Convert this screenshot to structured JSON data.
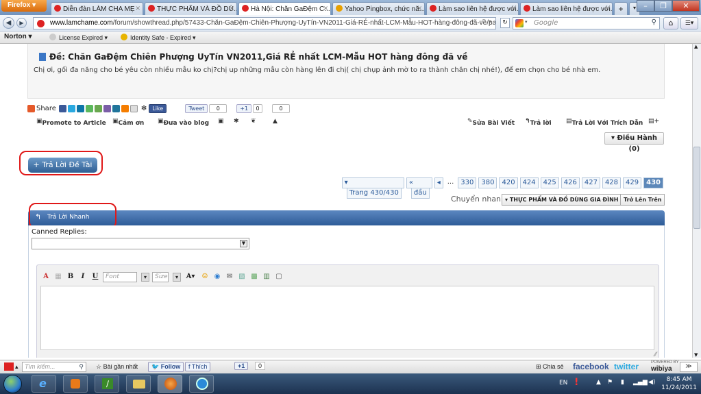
{
  "browser": {
    "menu_label": "Firefox",
    "tabs": [
      {
        "label": "Diễn đàn LÀM CHA MẸ",
        "active": false
      },
      {
        "label": "THỰC PHẨM VÀ ĐỒ DÙ...",
        "active": false
      },
      {
        "label": "Hà Nội: Chăn GaĐệm C...",
        "active": true
      },
      {
        "label": "Yahoo Pingbox, chức nă...",
        "active": false
      },
      {
        "label": "Làm sao liên hệ được với...",
        "active": false
      },
      {
        "label": "Làm sao liên hệ được với...",
        "active": false
      }
    ],
    "new_tab_symbol": "+",
    "url_host": "www.lamchame.com",
    "url_path": "/forum/showthread.php/57433-Chăn-GaĐệm-Chiên-Phượng-UyTín-VN2011-Giá-RẺ-nhất-LCM-Mẫu-HOT-hàng-đông-đã-về/page430",
    "search_placeholder": "Google"
  },
  "norton": {
    "brand": "Norton",
    "license": "License Expired",
    "identity": "Identity Safe - Expired"
  },
  "post": {
    "title": "Đề: Chăn GaĐệm Chiên Phượng UyTín VN2011,Giá RẺ nhất LCM-Mẫu HOT hàng đông đã về",
    "body": "Chị ơi, gối đa năng cho bé yêu còn nhiều mẫu ko chị?chị up những mẫu còn hàng lên đi chị( chị chụp ảnh mờ to ra thành chăn chị nhé!), để em chọn cho bé nhà em."
  },
  "share": {
    "share_label": "Share",
    "like_label": "Like",
    "tweet_label": "Tweet",
    "tweet_count": "0",
    "plusone_label": "+1",
    "plusone_count": "0",
    "other_count": "0"
  },
  "actions": {
    "promote": "Promote to Article",
    "thanks": "Cảm ơn",
    "blog": "Đưa vào blog",
    "edit": "Sửa Bài Viết",
    "reply": "Trả lời",
    "quote": "Trả Lời Với Trích Dẫn",
    "moderate": "Điều Hành (0)"
  },
  "thread": {
    "reply_button": "+ Trả Lời Đề Tài",
    "pager": {
      "page_label": "Trang 430/430",
      "first_label": "đầu",
      "ellipsis": "...",
      "pages": [
        "330",
        "380",
        "420",
        "424",
        "425",
        "426",
        "427",
        "428",
        "429",
        "430"
      ],
      "current": "430"
    },
    "jump_label": "Chuyển nhanh",
    "jump_value": "THỰC PHẨM VÀ ĐỒ DÙNG GIA ĐÌNH",
    "back_top": "Trở Lên Trên"
  },
  "quick_reply": {
    "title": "Trả Lời Nhanh",
    "canned_label": "Canned Replies:",
    "font_placeholder": "Font",
    "size_placeholder": "Size"
  },
  "addon_bar": {
    "search_placeholder": "Tìm kiếm...",
    "top_posts": "Bài gần nhất",
    "follow": "Follow",
    "like": "Thích",
    "plusone": "+1",
    "plusone_count": "0",
    "share": "Chia sẻ",
    "facebook": "facebook",
    "twitter": "twitter",
    "wibiya": "wibiya",
    "powered": "POWERED BY"
  },
  "taskbar": {
    "lang": "EN",
    "time": "8:45 AM",
    "date": "11/24/2011"
  },
  "colors": {
    "link_blue": "#2a5a9a",
    "header_blue": "#2e5c98",
    "highlight_red": "#e01818"
  }
}
